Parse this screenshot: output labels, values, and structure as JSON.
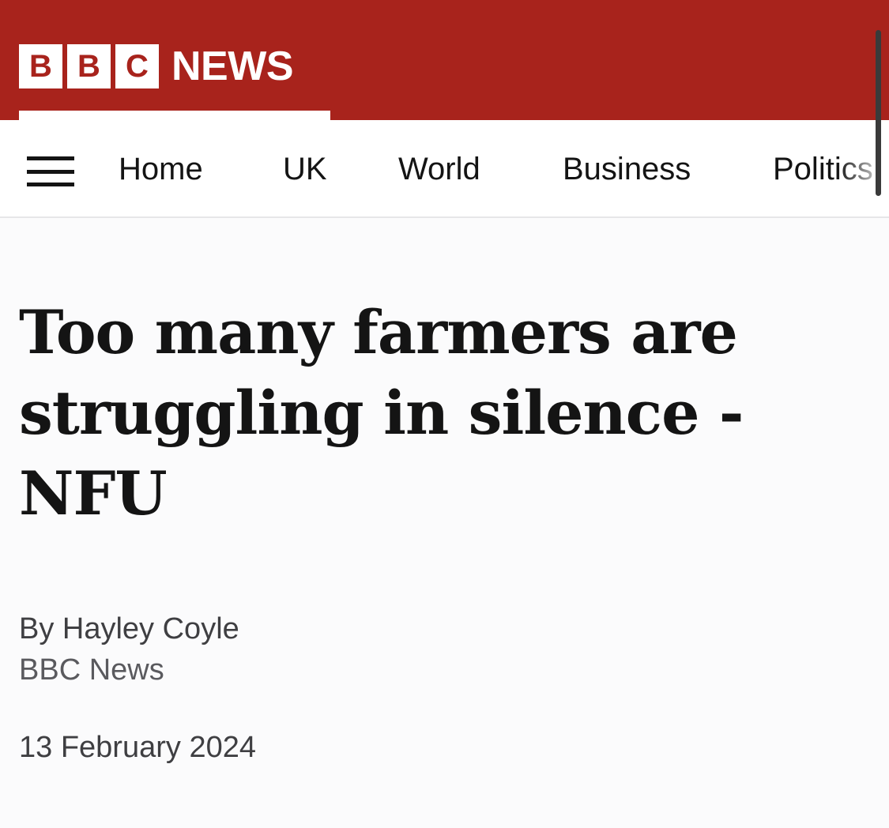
{
  "brand": {
    "blocks": [
      "B",
      "B",
      "C"
    ],
    "name": "NEWS",
    "color": "#a8231c"
  },
  "nav": {
    "menu_icon": "hamburger-menu-icon",
    "items": [
      "Home",
      "UK",
      "World",
      "Business",
      "Politics"
    ]
  },
  "article": {
    "headline": "Too many farmers are struggling in silence - NFU",
    "byline": "By Hayley Coyle",
    "source": "BBC News",
    "date": "13 February 2024"
  }
}
